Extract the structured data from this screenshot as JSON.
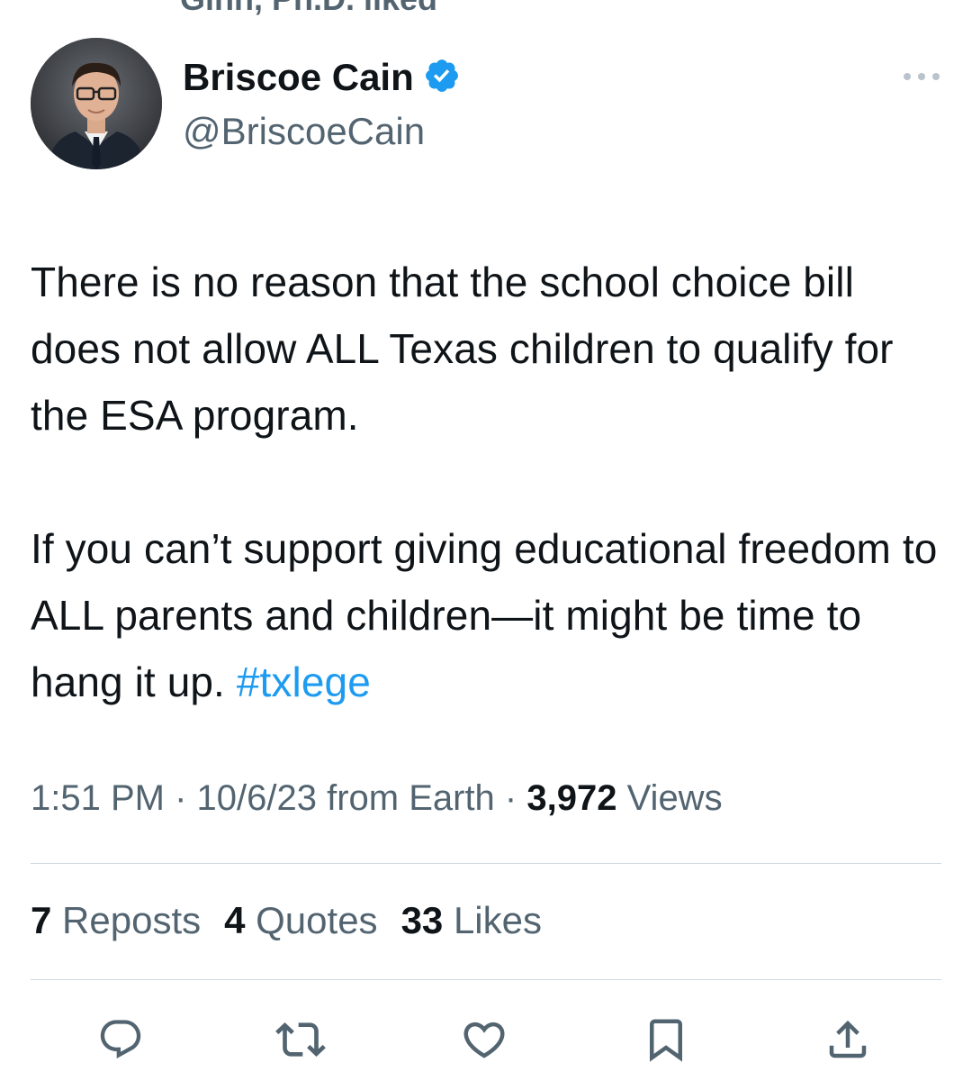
{
  "context": {
    "social_context_text": "Ginn, Ph.D. liked"
  },
  "author": {
    "display_name": "Briscoe Cain",
    "handle": "@BriscoeCain",
    "verified": true,
    "verified_color": "#1d9bf0"
  },
  "tweet": {
    "paragraph1": "There is no reason that the school choice bill does not allow ALL Texas children to qualify for the ESA program.",
    "paragraph2_text": "If you can’t support giving educational freedom to ALL parents and children—it might be time to hang it up.",
    "hashtag": "#txlege"
  },
  "meta": {
    "time": "1:51 PM",
    "sep1": " · ",
    "date_source": "10/6/23 from Earth",
    "sep2": " · ",
    "views_count": "3,972",
    "views_label": "Views"
  },
  "stats": {
    "reposts_count": "7",
    "reposts_label": "Reposts",
    "quotes_count": "4",
    "quotes_label": "Quotes",
    "likes_count": "33",
    "likes_label": "Likes"
  },
  "icons": {
    "more": "more-horizontal-icon",
    "reply": "reply-icon",
    "repost": "repost-icon",
    "like": "heart-icon",
    "bookmark": "bookmark-icon",
    "share": "share-icon"
  },
  "colors": {
    "text_primary": "#0f1419",
    "text_secondary": "#536471",
    "link": "#1d9bf0",
    "divider": "#cfd9de"
  }
}
